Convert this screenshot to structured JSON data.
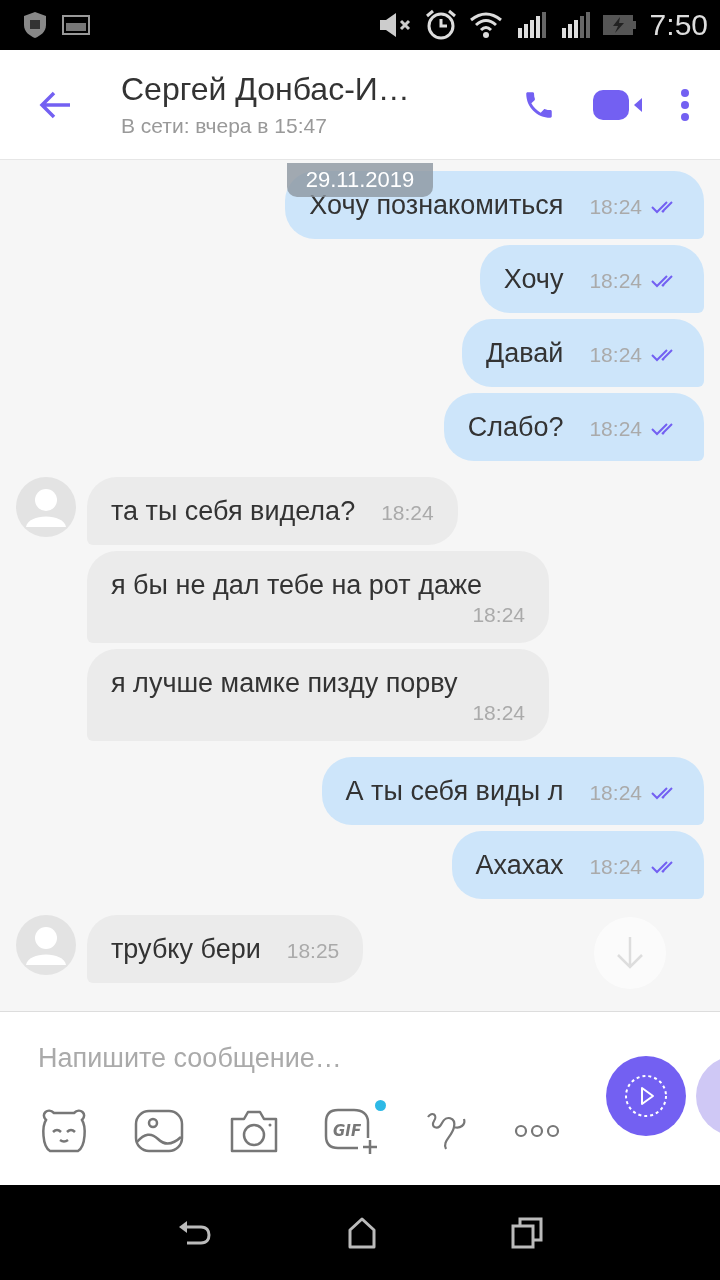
{
  "status_bar": {
    "time": "7:50"
  },
  "header": {
    "title": "Сергей Донбас-И…",
    "subtitle": "В сети: вчера в 15:47"
  },
  "date_badge": "29.11.2019",
  "messages": [
    {
      "kind": "outgoing",
      "text": "Хочу познакомиться",
      "time": "18:24",
      "read": true
    },
    {
      "kind": "outgoing",
      "text": "Хочу",
      "time": "18:24",
      "read": true
    },
    {
      "kind": "outgoing",
      "text": "Давай",
      "time": "18:24",
      "read": true
    },
    {
      "kind": "outgoing",
      "text": "Слабо?",
      "time": "18:24",
      "read": true
    },
    {
      "kind": "incoming",
      "text": "та ты себя видела?",
      "time": "18:24",
      "avatar": true
    },
    {
      "kind": "incoming",
      "text": "я бы не дал тебе на рот даже",
      "time": "18:24",
      "avatar": false
    },
    {
      "kind": "incoming",
      "text": "я лучше мамке пизду порву",
      "time": "18:24",
      "avatar": false
    },
    {
      "kind": "outgoing",
      "text": "А ты себя виды л",
      "time": "18:24",
      "read": true
    },
    {
      "kind": "outgoing",
      "text": "Ахахах",
      "time": "18:24",
      "read": true
    },
    {
      "kind": "incoming",
      "text": "трубку бери",
      "time": "18:25",
      "avatar": true
    }
  ],
  "composer": {
    "placeholder": "Напишите сообщение…",
    "gif_label": "GIF",
    "gif_new": true
  }
}
